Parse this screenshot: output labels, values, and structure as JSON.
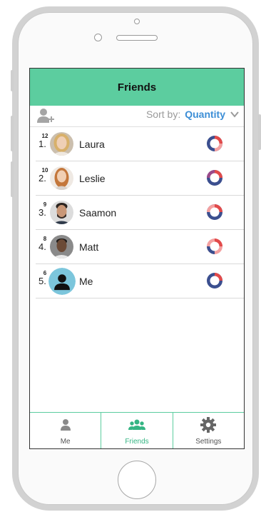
{
  "header": {
    "title": "Friends"
  },
  "toolbar": {
    "add_icon": "add-person-icon",
    "sort_label": "Sort by:",
    "sort_value": "Quantity",
    "sort_icon": "chevron-down-icon"
  },
  "friends": [
    {
      "rank": "1.",
      "name": "Laura",
      "count": "12",
      "avatar": "photo-woman-blonde"
    },
    {
      "rank": "2.",
      "name": "Leslie",
      "count": "10",
      "avatar": "photo-woman-red-hair"
    },
    {
      "rank": "3.",
      "name": "Saamon",
      "count": "9",
      "avatar": "photo-man-beard"
    },
    {
      "rank": "4.",
      "name": "Matt",
      "count": "8",
      "avatar": "photo-man-dark"
    },
    {
      "rank": "5.",
      "name": "Me",
      "count": "6",
      "avatar": "default-user-icon"
    }
  ],
  "tabs": [
    {
      "label": "Me",
      "icon": "person-icon",
      "active": false
    },
    {
      "label": "Friends",
      "icon": "group-icon",
      "active": true
    },
    {
      "label": "Settings",
      "icon": "gear-icon",
      "active": false
    }
  ],
  "colors": {
    "header_bg": "#5ccd9f",
    "accent_blue": "#3c8ed6",
    "active_tab": "#34b583"
  }
}
